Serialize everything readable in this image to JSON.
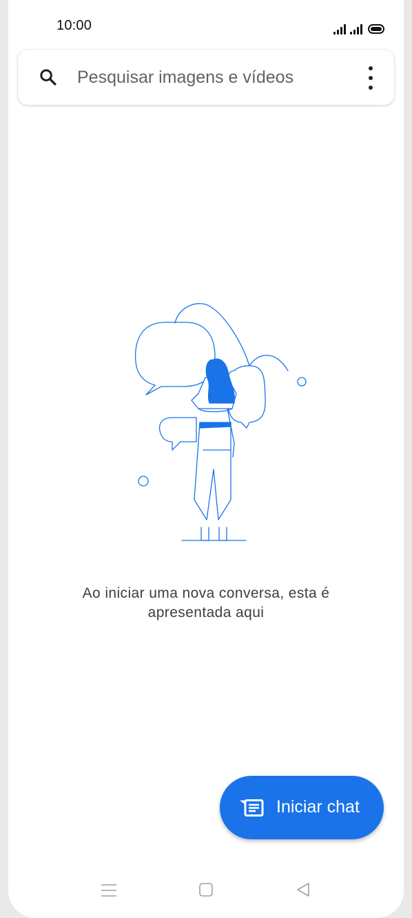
{
  "status_bar": {
    "time": "10:00",
    "icons": [
      "signal-icon",
      "signal-icon",
      "battery-icon"
    ]
  },
  "search": {
    "placeholder": "Pesquisar imagens e vídeos",
    "icon": "search-icon",
    "menu_icon": "more-vert-icon"
  },
  "empty_state": {
    "illustration": "person-with-speech-bubbles",
    "message": "Ao iniciar uma nova conversa, esta é apresentada aqui"
  },
  "fab": {
    "label": "Iniciar chat",
    "icon": "chat-message-icon"
  },
  "nav_bar": {
    "icons": [
      "menu-icon",
      "home-icon",
      "back-icon"
    ]
  },
  "colors": {
    "accent": "#1a73e8",
    "illustration_stroke": "#1a73e8",
    "text_secondary": "#3c4043"
  }
}
